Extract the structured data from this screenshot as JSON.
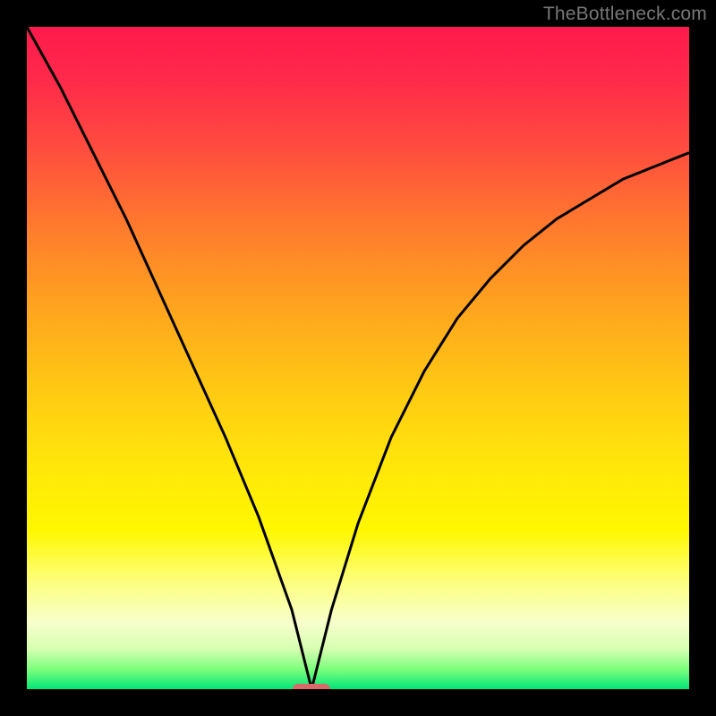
{
  "watermark": {
    "text": "TheBottleneck.com"
  },
  "colors": {
    "frame": "#000000",
    "curve": "#000000",
    "marker": "#d86a6a",
    "gradient_stops": [
      "#ff1a4d",
      "#ff2a4a",
      "#ff4b3f",
      "#ff7a2d",
      "#ffa31f",
      "#ffc714",
      "#ffe60a",
      "#fff700",
      "#fdff80",
      "#f7ffcc",
      "#d6ffb0",
      "#7dff7d",
      "#00e676"
    ]
  },
  "chart_data": {
    "type": "line",
    "title": "",
    "xlabel": "",
    "ylabel": "",
    "xlim": [
      0,
      100
    ],
    "ylim": [
      0,
      100
    ],
    "minimum_x": 43,
    "marker": {
      "x": 43,
      "width_pct": 5.7
    },
    "series": [
      {
        "name": "left-branch",
        "x": [
          0,
          5,
          10,
          15,
          20,
          25,
          30,
          35,
          40,
          43
        ],
        "values": [
          100,
          91,
          81,
          71,
          60,
          49,
          38,
          26,
          12,
          0
        ]
      },
      {
        "name": "right-branch",
        "x": [
          43,
          46,
          50,
          55,
          60,
          65,
          70,
          75,
          80,
          85,
          90,
          95,
          100
        ],
        "values": [
          0,
          12,
          25,
          38,
          48,
          56,
          62,
          67,
          71,
          74,
          77,
          79,
          81
        ]
      }
    ]
  }
}
